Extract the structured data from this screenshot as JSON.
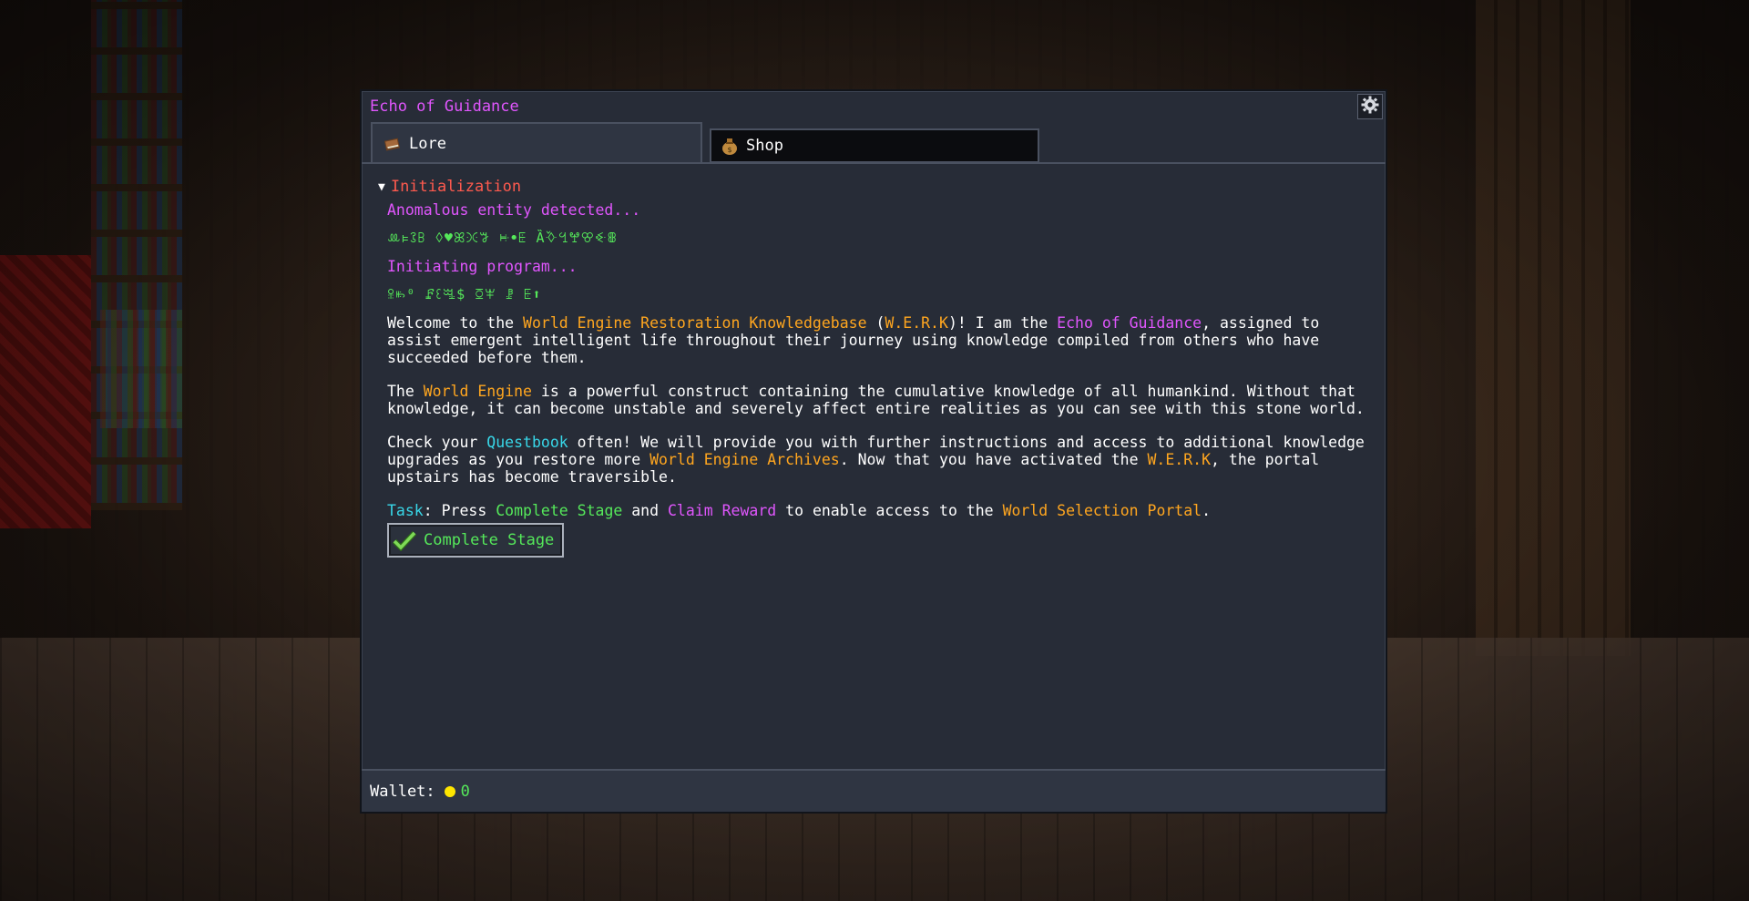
{
  "window": {
    "title": "Echo of Guidance"
  },
  "tabs": [
    {
      "label": "Lore",
      "icon": "book-icon",
      "active": true
    },
    {
      "label": "Shop",
      "icon": "money-bag-icon",
      "active": false
    }
  ],
  "section": {
    "title": "Initialization",
    "expanded": true
  },
  "lines": {
    "anomalous": "Anomalous entity detected...",
    "glyphs1": "ꔛ⊧ꕘꕗ ꕺ♥ꕤꖻꗌ ꔜꔷꗍ Ȁ̌ꕻꔇꖡꕢꔾꕬ",
    "initiating": "Initiating program...",
    "glyphs2": "ꕉꖳ⁰ ꗕꘓꗆ$ ꗞꕽ ꗗ ꗍ⬆"
  },
  "para1": {
    "a": "Welcome to the ",
    "b": "World Engine Restoration Knowledgebase",
    "c": " (",
    "d": "W.E.R.K",
    "e": ")! I am the ",
    "f": "Echo of Guidance",
    "g": ", assigned to assist emergent intelligent life throughout their journey using knowledge compiled from others who have succeeded before them."
  },
  "para2": {
    "a": "The ",
    "b": "World Engine",
    "c": " is a powerful construct containing the cumulative knowledge of all humankind. Without that knowledge, it can become unstable and severely affect entire realities as you can see with this stone world."
  },
  "para3": {
    "a": "Check your ",
    "b": "Questbook",
    "c": " often! We will provide you with further instructions and access to additional knowledge upgrades as you restore more ",
    "d": "World Engine Archives",
    "e": ". Now that you have activated the ",
    "f": "W.E.R.K",
    "g": ", the portal upstairs has become traversible."
  },
  "task": {
    "label": "Task",
    "a": ": Press ",
    "b": "Complete Stage",
    "c": " and ",
    "d": "Claim Reward",
    "e": " to enable access to the ",
    "f": "World Selection Portal",
    "g": "."
  },
  "complete_button": {
    "label": "Complete Stage",
    "icon": "checkmark-icon"
  },
  "footer": {
    "wallet_label": "Wallet:",
    "coin_icon": "coin-icon",
    "wallet_value": "0"
  },
  "colors": {
    "title": "#e056fd",
    "section": "#ff5a4e",
    "highlight": "#ffa61f",
    "link": "#38d7e8",
    "success": "#55e85a",
    "coin": "#ffe600"
  }
}
